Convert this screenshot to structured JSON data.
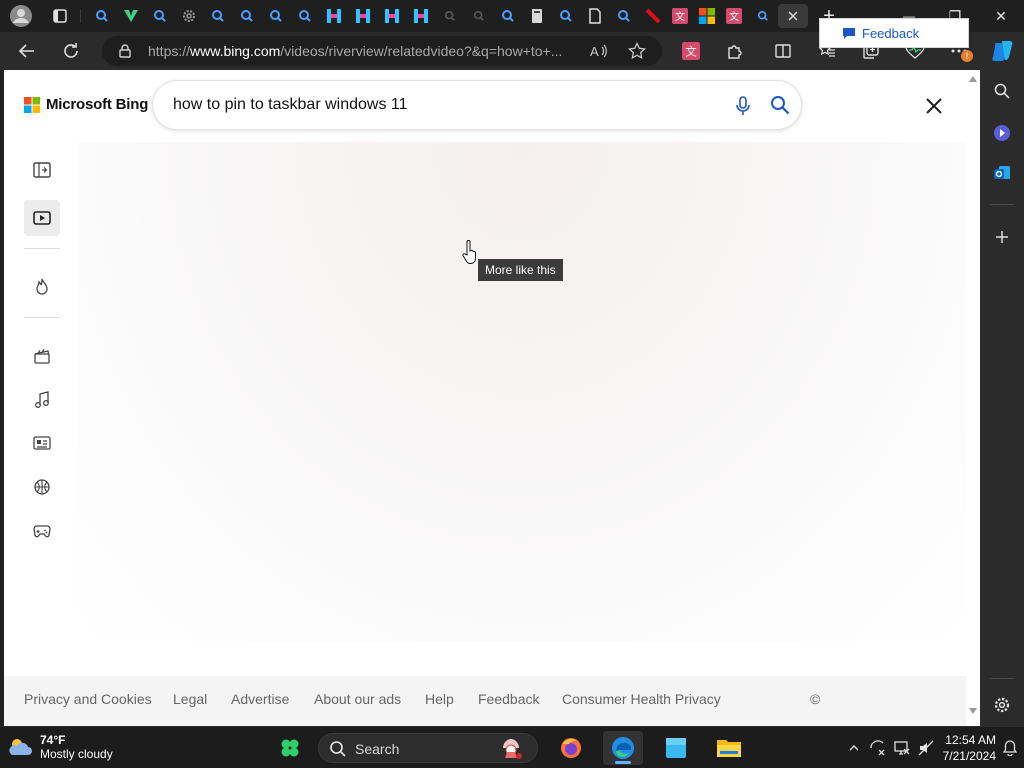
{
  "browser": {
    "tabs": [
      {
        "icon": "profile-avatar"
      },
      {
        "icon": "tab-actions"
      },
      {
        "icon": "bing-search"
      },
      {
        "icon": "vuetify-v"
      },
      {
        "icon": "bing-search"
      },
      {
        "icon": "settings-gear"
      },
      {
        "icon": "bing-search"
      },
      {
        "icon": "bing-search"
      },
      {
        "icon": "bing-search"
      },
      {
        "icon": "bing-search"
      },
      {
        "icon": "hive-h"
      },
      {
        "icon": "hive-h"
      },
      {
        "icon": "hive-h"
      },
      {
        "icon": "hive-h"
      },
      {
        "icon": "bing-search-dim"
      },
      {
        "icon": "bing-search-dim"
      },
      {
        "icon": "bing-search"
      },
      {
        "icon": "book"
      },
      {
        "icon": "bing-search"
      },
      {
        "icon": "document"
      },
      {
        "icon": "bing-search"
      },
      {
        "icon": "red-flag"
      },
      {
        "icon": "translate"
      },
      {
        "icon": "microsoft-logo"
      },
      {
        "icon": "translate"
      },
      {
        "icon": "bing-search-active"
      }
    ],
    "new_tab_symbol": "+",
    "window_controls": {
      "minimize": "—",
      "restore": "❐",
      "close": "✕"
    },
    "address": {
      "prefix": "https://",
      "domain": "www.bing.com",
      "path": "/videos/riverview/relatedvideo?&q=how+to+..."
    },
    "extension_badge": "!"
  },
  "page": {
    "logo_text": "Microsoft Bing",
    "query": "how to pin to taskbar windows 11",
    "tooltip": "More like this",
    "footer_links": [
      "Privacy and Cookies",
      "Legal",
      "Advertise",
      "About our ads",
      "Help",
      "Feedback",
      "Consumer Health Privacy"
    ],
    "copyright_symbol": "©",
    "feedback_button": "Feedback",
    "colors": {
      "brand_blue": "#1a56c9",
      "ms_red": "#f25022",
      "ms_green": "#7fba00",
      "ms_blue": "#00a4ef",
      "ms_yellow": "#ffb900"
    }
  },
  "taskbar": {
    "weather_temp": "74°F",
    "weather_desc": "Mostly cloudy",
    "search_label": "Search",
    "time": "12:54 AM",
    "date": "7/21/2024"
  }
}
